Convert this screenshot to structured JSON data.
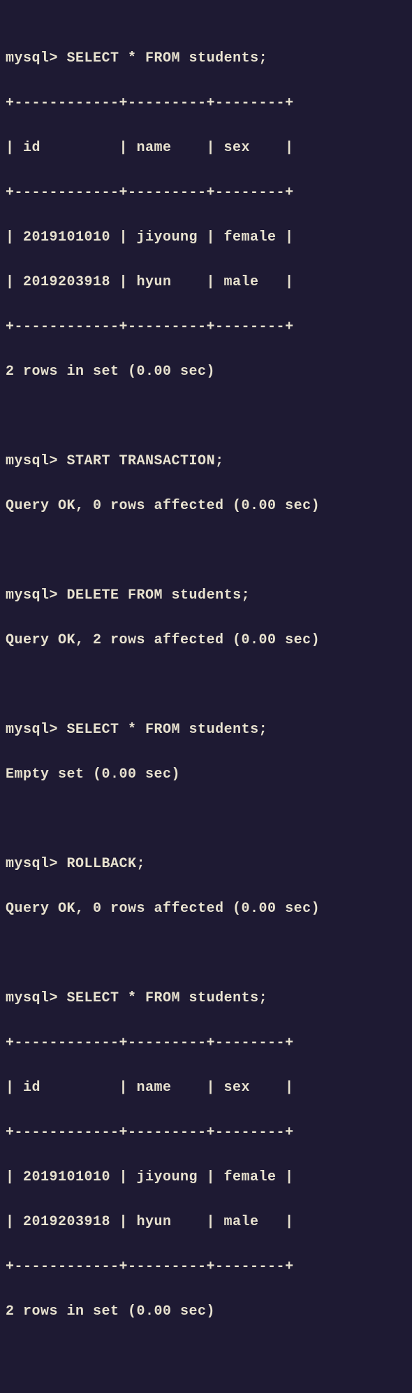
{
  "prompt": "mysql>",
  "queries": {
    "select1": "SELECT * FROM students;",
    "start_tx": "START TRANSACTION;",
    "delete": "DELETE FROM students;",
    "select2": "SELECT * FROM students;",
    "rollback": "ROLLBACK;",
    "select3": "SELECT * FROM students;"
  },
  "table": {
    "border_top": "+------------+---------+--------+",
    "header": "| id         | name    | sex    |",
    "border_mid": "+------------+---------+--------+",
    "row1": "| 2019101010 | jiyoung | female |",
    "row2": "| 2019203918 | hyun    | male   |",
    "border_bot": "+------------+---------+--------+"
  },
  "results": {
    "rows2": "2 rows in set (0.00 sec)",
    "ok0": "Query OK, 0 rows affected (0.00 sec)",
    "ok2": "Query OK, 2 rows affected (0.00 sec)",
    "empty": "Empty set (0.00 sec)"
  }
}
